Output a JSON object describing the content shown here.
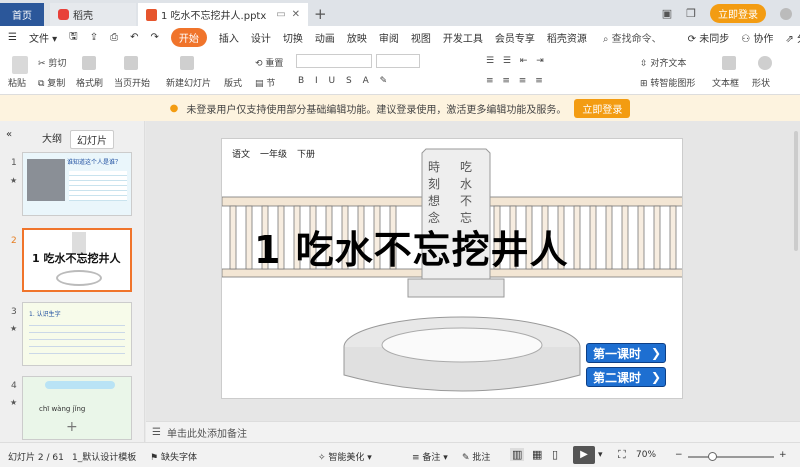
{
  "tabs": {
    "home": "首页",
    "daoke": "稻壳",
    "file": "1 吃水不忘挖井人.pptx"
  },
  "login_label": "立即登录",
  "menu": {
    "file": "文件",
    "start": "开始",
    "items": [
      "插入",
      "设计",
      "切换",
      "动画",
      "放映",
      "审阅",
      "视图",
      "开发工具",
      "会员专享",
      "稻壳资源"
    ],
    "search": "查找命令、",
    "sync": "未同步",
    "collab": "协作",
    "share": "分享"
  },
  "ribbon": {
    "paste": "粘贴",
    "cut": "剪切",
    "copy": "复制",
    "format_painter": "格式刷",
    "from_current": "当页开始",
    "new_slide": "新建幻灯片",
    "layout": "版式",
    "section": "节",
    "reset": "重置",
    "align_text": "对齐文本",
    "smartart": "转智能图形",
    "textbox": "文本框",
    "shape": "形状"
  },
  "notice": {
    "text": "未登录用户仅支持使用部分基础编辑功能。建议登录使用，激活更多编辑功能及服务。",
    "button": "立即登录"
  },
  "panel": {
    "outline": "大纲",
    "slides": "幻灯片",
    "thumbs": [
      {
        "num": "1",
        "text": "谁知道这个人是谁？"
      },
      {
        "num": "2",
        "text": "1 吃水不忘挖井人"
      },
      {
        "num": "3",
        "text": "1. 认识生字"
      },
      {
        "num": "4",
        "text": "chī  wàng  jǐng"
      }
    ]
  },
  "slide": {
    "subject": "语文",
    "grade": "一年级",
    "term": "下册",
    "title": "1  吃水不忘挖井人",
    "tablet_left": "時刻想念",
    "tablet_right": "吃水不忘",
    "btn1": "第一课时",
    "btn2": "第二课时"
  },
  "notes_placeholder": "单击此处添加备注",
  "status": {
    "slide_pos": "幻灯片 2 / 61",
    "template": "1_默认设计模板",
    "missing_font": "缺失字体",
    "beautify": "智能美化",
    "notes": "备注",
    "comments": "批注",
    "zoom": "70%"
  }
}
